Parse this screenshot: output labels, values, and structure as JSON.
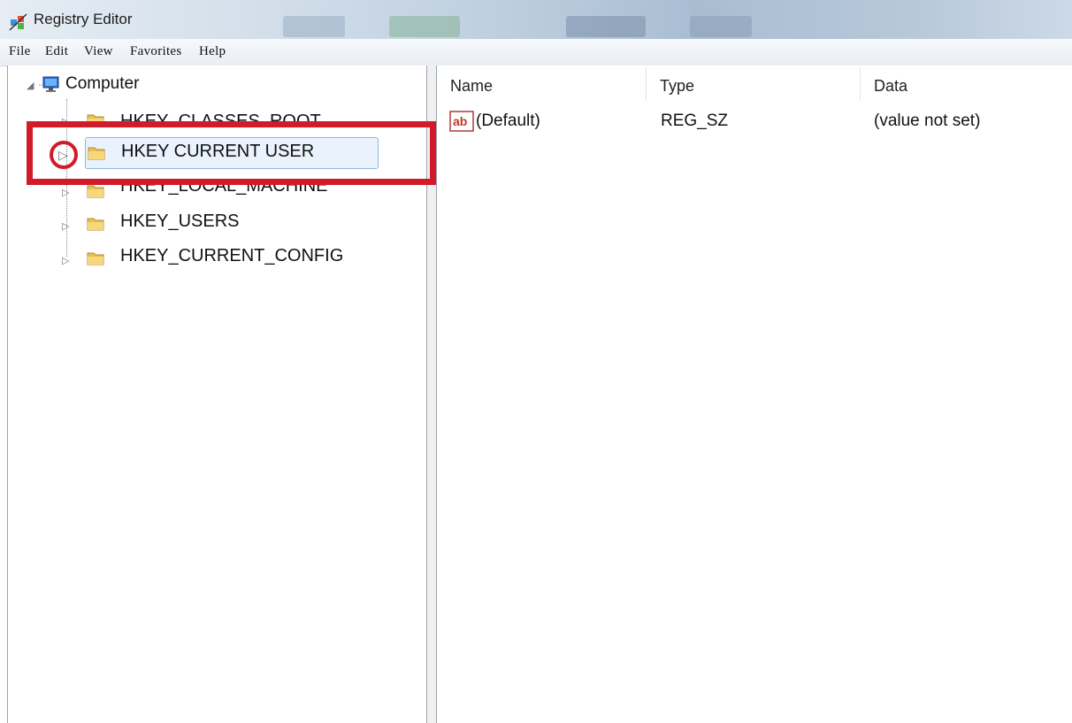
{
  "window": {
    "title": "Registry Editor",
    "accent_color": "#d11a2a",
    "selection_color": "#eaf3fd"
  },
  "menu": [
    "File",
    "Edit",
    "View",
    "Favorites",
    "Help"
  ],
  "tree": {
    "root": "Computer",
    "keys": [
      {
        "label": "HKEY_CLASSES_ROOT",
        "expanded": false,
        "selected": false
      },
      {
        "label": "HKEY CURRENT USER",
        "expanded": false,
        "selected": true
      },
      {
        "label": "HKEY_LOCAL_MACHINE",
        "expanded": false,
        "selected": false
      },
      {
        "label": "HKEY_USERS",
        "expanded": false,
        "selected": false
      },
      {
        "label": "HKEY_CURRENT_CONFIG",
        "expanded": false,
        "selected": false
      }
    ]
  },
  "list": {
    "columns": [
      "Name",
      "Type",
      "Data"
    ],
    "rows": [
      {
        "icon": "string-value-icon",
        "name": "(Default)",
        "type": "REG_SZ",
        "data": "(value not set)"
      }
    ]
  },
  "icons": {
    "app": "registry-editor-icon",
    "root": "computer-icon",
    "keys": "folder-icon",
    "expander": "triangle-right-icon"
  }
}
